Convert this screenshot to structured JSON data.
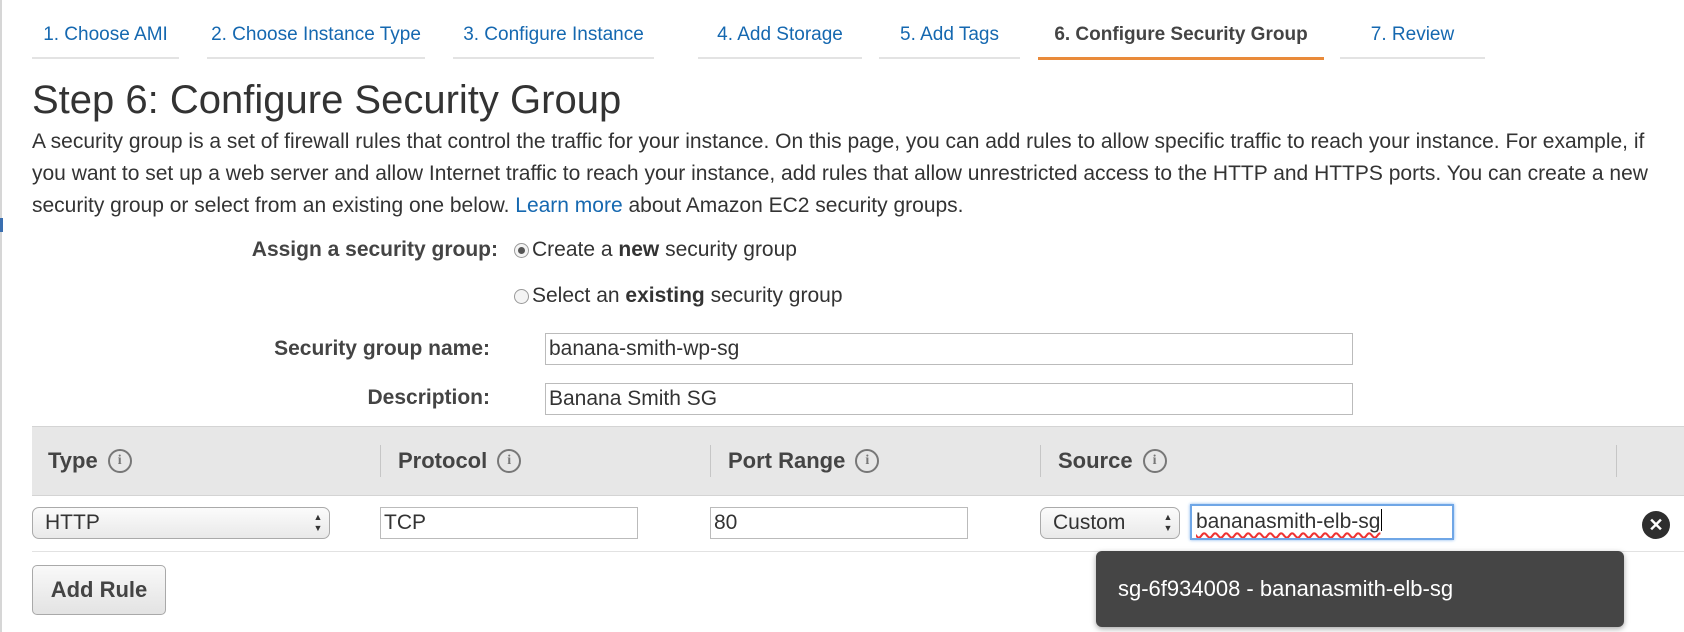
{
  "wizard": {
    "tabs": [
      {
        "label": "1. Choose AMI"
      },
      {
        "label": "2. Choose Instance Type"
      },
      {
        "label": "3. Configure Instance"
      },
      {
        "label": "4. Add Storage"
      },
      {
        "label": "5. Add Tags"
      },
      {
        "label": "6. Configure Security Group",
        "active": true
      },
      {
        "label": "7. Review"
      }
    ]
  },
  "page": {
    "title": "Step 6: Configure Security Group",
    "intro_text": "A security group is a set of firewall rules that control the traffic for your instance. On this page, you can add rules to allow specific traffic to reach your instance. For example, if you want to set up a web server and allow Internet traffic to reach your instance, add rules that allow unrestricted access to the HTTP and HTTPS ports. You can create a new security group or select from an existing one below.",
    "learn_more_link": "Learn more",
    "intro_suffix": "about Amazon EC2 security groups."
  },
  "assign": {
    "label": "Assign a security group:",
    "option_new": {
      "prefix": "Create a",
      "bold": "new",
      "suffix": "security group",
      "selected": true
    },
    "option_existing": {
      "prefix": "Select an",
      "bold": "existing",
      "suffix": "security group",
      "selected": false
    }
  },
  "form": {
    "name_label": "Security group name:",
    "name_value": "banana-smith-wp-sg",
    "description_label": "Description:",
    "description_value": "Banana Smith SG"
  },
  "rules": {
    "headers": [
      "Type",
      "Protocol",
      "Port Range",
      "Source"
    ],
    "info_icon_glyph": "i",
    "row": {
      "type": "HTTP",
      "protocol": "TCP",
      "port_range": "80",
      "source_type": "Custom",
      "source_value": "bananasmith-elb-sg"
    },
    "remove_glyph": "✕",
    "add_rule_label": "Add Rule"
  },
  "autocomplete": {
    "items": [
      "sg-6f934008 - bananasmith-elb-sg"
    ]
  },
  "colors": {
    "link": "#1568b0",
    "active_tab_underline": "#e98a3a",
    "dropdown_bg": "#454545",
    "focus_ring": "#6fa6e6"
  }
}
